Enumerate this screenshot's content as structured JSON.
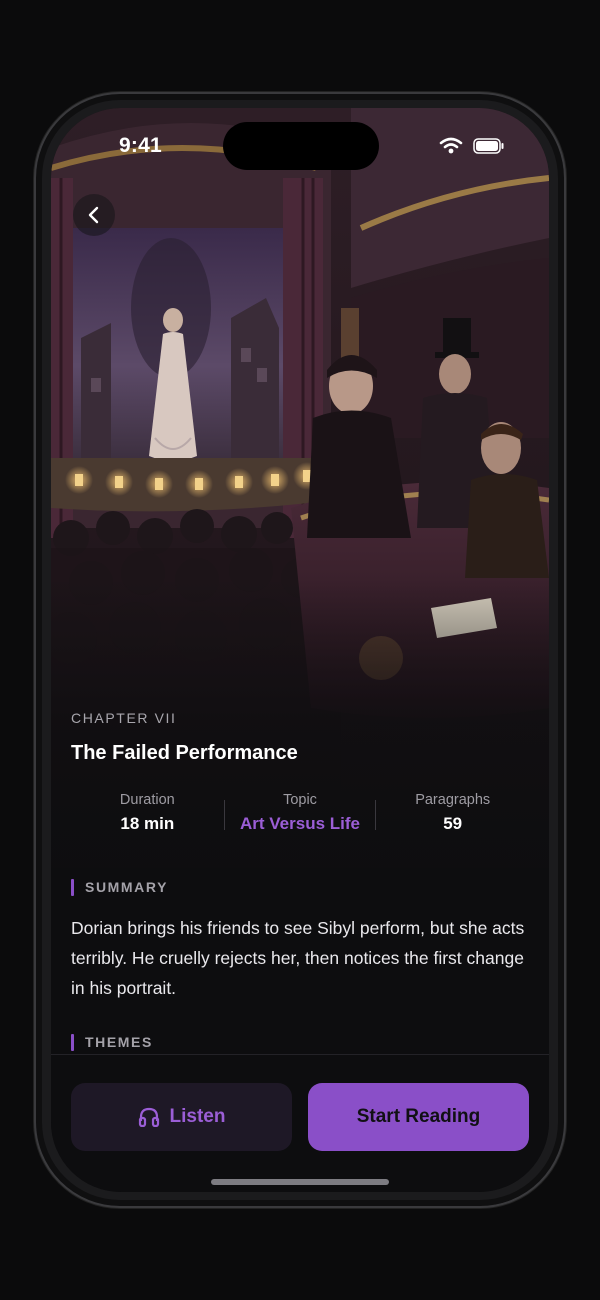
{
  "status_bar": {
    "time": "9:41",
    "wifi_icon": "wifi-icon",
    "battery_icon": "battery-icon"
  },
  "nav": {
    "back_icon": "chevron-left-icon"
  },
  "hero": {
    "image": "theatre-illustration"
  },
  "chapter": {
    "label": "CHAPTER VII",
    "title": "The Failed Performance"
  },
  "stats": [
    {
      "label": "Duration",
      "value": "18 min"
    },
    {
      "label": "Topic",
      "value": "Art Versus Life"
    },
    {
      "label": "Paragraphs",
      "value": "59"
    }
  ],
  "summary": {
    "heading": "SUMMARY",
    "text": "Dorian brings his friends to see Sibyl perform, but she acts terribly. He cruelly rejects her, then notices the first change in his portrait."
  },
  "themes": {
    "heading": "THEMES"
  },
  "actions": {
    "listen_label": "Listen",
    "listen_icon": "headphones-icon",
    "read_label": "Start Reading"
  },
  "colors": {
    "accent": "#8a4fc8",
    "accent_text": "#9b5ed6",
    "background": "#0d0d0f"
  }
}
